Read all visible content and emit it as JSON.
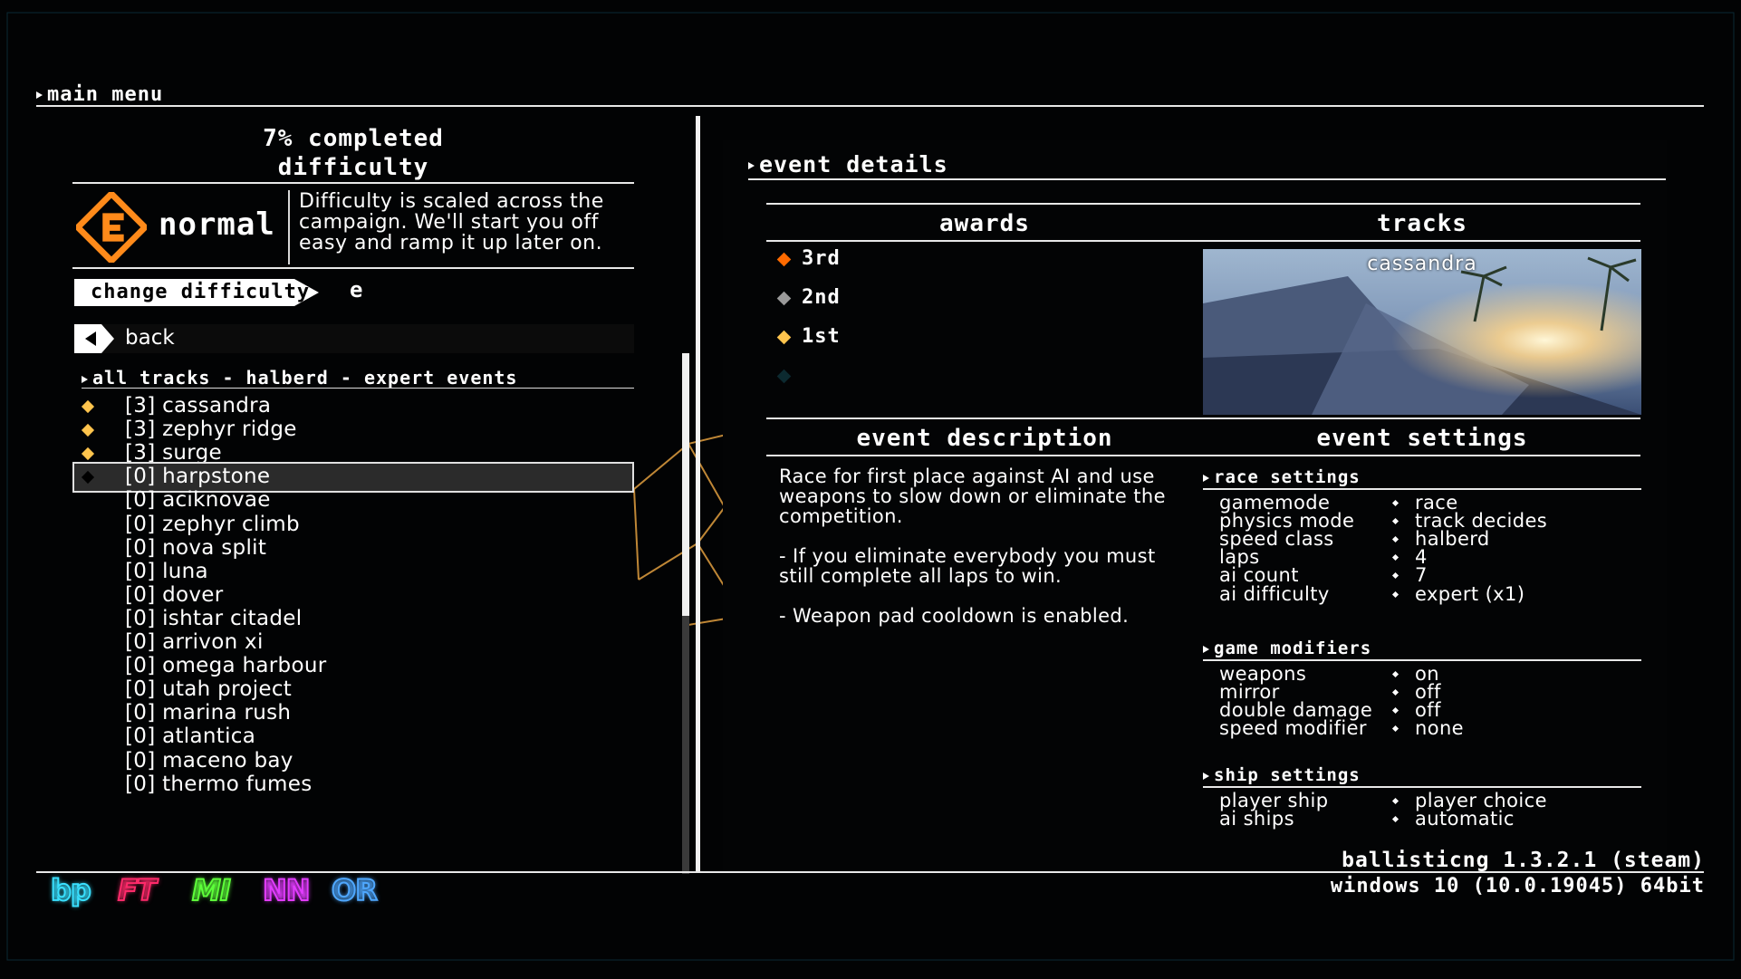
{
  "main_menu": {
    "label": "main menu"
  },
  "left": {
    "completed": "7% completed",
    "difficulty_title": "difficulty",
    "difficulty_name": "normal",
    "difficulty_desc": "Difficulty is scaled across the campaign. We'll start you off easy and ramp it up later on.",
    "change_difficulty": "change difficulty",
    "change_key": "e",
    "back": "back",
    "tracks_header": "all tracks - halberd - expert events",
    "tracks": [
      {
        "name": "[3] cassandra",
        "award": "gold"
      },
      {
        "name": "[3] zephyr ridge",
        "award": "gold"
      },
      {
        "name": "[3] surge",
        "award": "gold"
      },
      {
        "name": "[0] harpstone",
        "award": "none",
        "selected": true
      },
      {
        "name": "[0] aciknovae",
        "award": ""
      },
      {
        "name": "[0] zephyr climb",
        "award": ""
      },
      {
        "name": "[0] nova split",
        "award": ""
      },
      {
        "name": "[0] luna",
        "award": ""
      },
      {
        "name": "[0] dover",
        "award": ""
      },
      {
        "name": "[0] ishtar citadel",
        "award": ""
      },
      {
        "name": "[0] arrivon xi",
        "award": ""
      },
      {
        "name": "[0] omega harbour",
        "award": ""
      },
      {
        "name": "[0] utah project",
        "award": ""
      },
      {
        "name": "[0] marina rush",
        "award": ""
      },
      {
        "name": "[0] atlantica",
        "award": ""
      },
      {
        "name": "[0] maceno bay",
        "award": ""
      },
      {
        "name": "[0] thermo fumes",
        "award": ""
      }
    ]
  },
  "right": {
    "title": "event details",
    "awards_head": "awards",
    "tracks_head": "tracks",
    "awards": [
      {
        "label": "3rd",
        "color": "#ff6a00"
      },
      {
        "label": "2nd",
        "color": "#9a9a9a"
      },
      {
        "label": "1st",
        "color": "#ffc44d"
      }
    ],
    "track_preview_name": "cassandra",
    "event_description_head": "event description",
    "event_settings_head": "event settings",
    "event_description": [
      "Race for first place against AI and use weapons to slow down or eliminate the competition.",
      "- If you eliminate everybody you must still complete all laps to win.",
      "- Weapon pad cooldown is enabled."
    ],
    "race_settings_head": "race settings",
    "race_settings": [
      {
        "k": "gamemode",
        "v": "race"
      },
      {
        "k": "physics mode",
        "v": "track decides"
      },
      {
        "k": "speed class",
        "v": "halberd"
      },
      {
        "k": "laps",
        "v": "4"
      },
      {
        "k": "ai count",
        "v": "7"
      },
      {
        "k": "ai difficulty",
        "v": "expert (x1)"
      }
    ],
    "game_modifiers_head": "game modifiers",
    "game_modifiers": [
      {
        "k": "weapons",
        "v": "on"
      },
      {
        "k": "mirror",
        "v": "off"
      },
      {
        "k": "double damage",
        "v": "off"
      },
      {
        "k": "speed modifier",
        "v": "none"
      }
    ],
    "ship_settings_head": "ship settings",
    "ship_settings": [
      {
        "k": "player ship",
        "v": "player choice"
      },
      {
        "k": "ai ships",
        "v": "automatic"
      }
    ]
  },
  "footer": {
    "version": "ballisticng 1.3.2.1 (steam)",
    "os": "windows 10  (10.0.19045) 64bit",
    "logos": [
      {
        "text": "bp",
        "color": "#39e0ff"
      },
      {
        "text": "FT",
        "color": "#ff2a6a"
      },
      {
        "text": "MI",
        "color": "#5dff3a"
      },
      {
        "text": "NN",
        "color": "#e23cff"
      },
      {
        "text": "OR",
        "color": "#4fa8ff"
      }
    ]
  },
  "colors": {
    "accent": "#ff8a1a",
    "gold": "#ffc44d"
  }
}
